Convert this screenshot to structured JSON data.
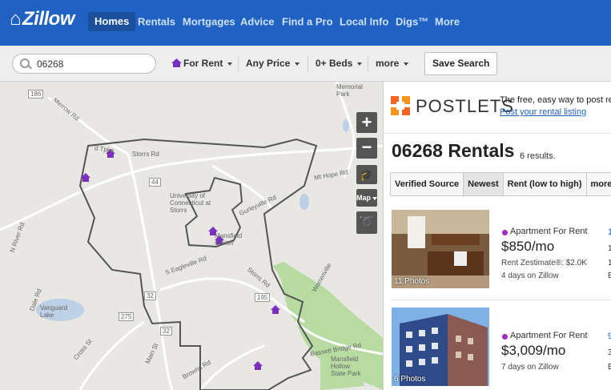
{
  "nav": {
    "logo": "Zillow",
    "items": [
      "Homes",
      "Rentals",
      "Mortgages",
      "Advice",
      "Find a Pro",
      "Local Info",
      "Digs™",
      "More"
    ]
  },
  "search": {
    "value": "06268",
    "for_rent": "For Rent",
    "price": "Any Price",
    "beds": "0+ Beds",
    "more": "more",
    "save": "Save Search"
  },
  "map": {
    "labels": {
      "memorial_park": "Memorial Park",
      "merrow": "Merrow Rd",
      "tpke": "d Tpke",
      "storrs_rd_top": "Storrs Rd",
      "mt_hope": "Mt Hope Rd",
      "university": "University of Connecticut at Storrs",
      "storrs": "Storrs",
      "mansfield": "Mansfield Center",
      "gurleyville": "Gurleyville Rd",
      "eagleville": "S Eagleville Rd",
      "storrs_rd": "Storrs Rd",
      "warrenville": "Warrenville",
      "n_river": "N River Rd",
      "dale": "Dale Rd",
      "vanguard": "Vanguard Lake",
      "cross": "Cross St",
      "main": "Main St",
      "browns": "Browns Rd",
      "bassett": "Bassett Bridge Rd",
      "hollow": "Mansfield Hollow State Park",
      "r195": "195",
      "r44": "44",
      "r32": "32",
      "r275": "275",
      "r186": "186",
      "map_btn": "Map"
    }
  },
  "postlets": {
    "name": "POSTLETS",
    "tagline": "The free, easy way to post re",
    "link": "Post your rental listing"
  },
  "results": {
    "title": "06268 Rentals",
    "count": "6 results."
  },
  "sort": [
    "Verified Source",
    "Newest",
    "Rent (low to high)",
    "more"
  ],
  "listings": [
    {
      "type": "Apartment For Rent",
      "price": "$850/mo",
      "zestimate": "Rent Zestimate®: $2.0K",
      "days": "4 days on Zillow",
      "photos": "11 Photos",
      "col": [
        "1",
        "1",
        "1!",
        "B"
      ]
    },
    {
      "type": "Apartment For Rent",
      "price": "$3,009/mo",
      "days": "7 days on Zillow",
      "photos": "6 Photos",
      "col": [
        "9",
        "3",
        "B"
      ]
    }
  ],
  "colors": {
    "nav": "#1f62c4",
    "pin": "#7b2fbf",
    "water": "#bcd0e6",
    "park": "#b7dba0"
  }
}
